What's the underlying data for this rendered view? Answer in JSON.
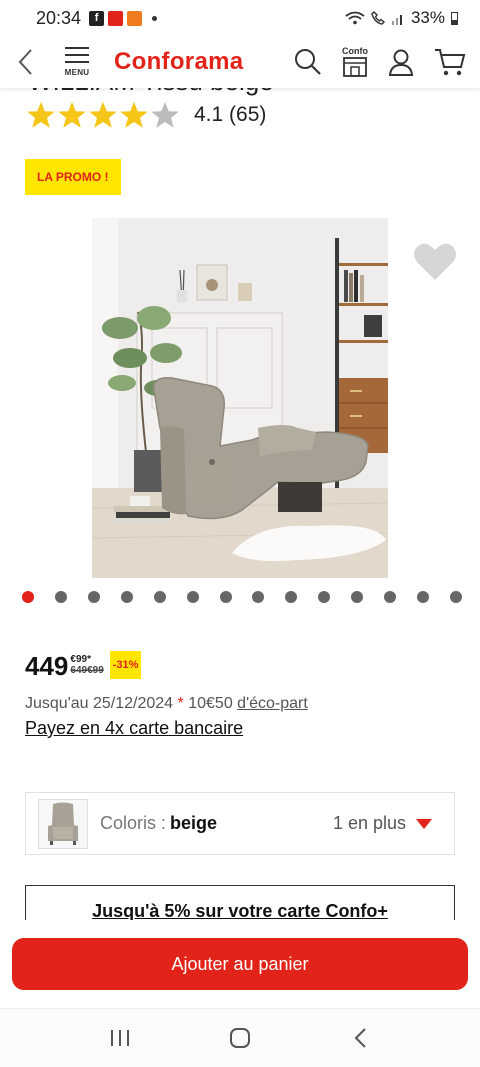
{
  "status_bar": {
    "time": "20:34",
    "battery": "33%"
  },
  "header": {
    "menu_label": "MENU",
    "logo": "Conforama",
    "confo_label": "Confo",
    "icons": [
      "back-icon",
      "menu-icon",
      "search-icon",
      "confo-card-icon",
      "account-icon",
      "cart-icon"
    ]
  },
  "product": {
    "title": "WILLIAM Tissu beige",
    "rating_value": 4.1,
    "rating_text": "4.1 (65)",
    "promo_badge": "LA PROMO !",
    "image_alt": "recliner-armchair-beige",
    "carousel": {
      "count": 14,
      "active_index": 0
    },
    "price": {
      "main": "449",
      "cents": "€99",
      "asterisk": "*",
      "old": "649€99",
      "discount": "-31%"
    },
    "deadline_prefix": "Jusqu'au 25/12/2024",
    "deadline_asterisk": "*",
    "eco_amount": "10€50",
    "eco_link": "d'éco-part",
    "payment_link": "Payez en 4x carte bancaire",
    "variant": {
      "label": "Coloris",
      "separator": " : ",
      "value": "beige",
      "more": "1 en plus"
    },
    "confo_promo": "Jusqu'à 5% sur votre carte Confo+"
  },
  "cart_button": "Ajouter au panier",
  "colors": {
    "brand_red": "#e2231a",
    "promo_yellow": "#ffe500",
    "star_gold": "#f5c518"
  }
}
